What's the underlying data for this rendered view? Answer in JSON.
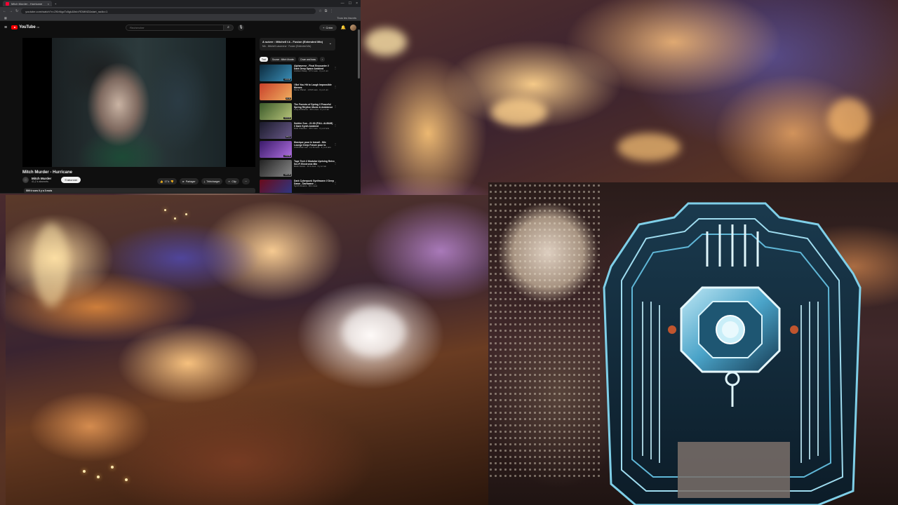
{
  "browser": {
    "tab_title": "Mitch Murder - Hurricane",
    "url": "youtube.com/watch?v=ZKbNgcTo5gk&list=RDMMZ&start_radio=1",
    "bookmarks_right": "Tous les favoris"
  },
  "youtube": {
    "logo_text": "YouTube",
    "logo_region": "FR",
    "search_placeholder": "Rechercher",
    "create_label": "Créer",
    "video_title": "Mitch Murder - Hurricane",
    "channel_name": "Mitch Murder",
    "channel_subs": "41,2 k abonnés",
    "subscribe_label": "S'abonner",
    "actions": {
      "like_count": "17 k",
      "share": "Partager",
      "download": "Télécharger",
      "clip": "Clip"
    },
    "views_line": "509 k vues  il y a 3 mois",
    "live_chat": {
      "title": "A suivre : Mitchell t.k - Fusion (Extended Mix)",
      "subtitle": "Mix - Mitchell Lasonneur · Fusion (Extended Mix)"
    },
    "chips": [
      "Tout",
      "Source : Mitch Murder",
      "Drum and bass"
    ],
    "recommendations": [
      {
        "title": "Alphaverse - Final Encounter // Dark Deep Space Ambient",
        "meta": "Ambient Sleep · 27 k vues · il y a 1 an",
        "duration": "1:00:00",
        "colors": [
          "#0c2a3d",
          "#3a8fb8"
        ]
      },
      {
        "title": "I Bet You Hit to Laugh Impossible Memes",
        "meta": "Meme Planet · 1,8 M vues · il y a 1 an",
        "duration": "12:44",
        "colors": [
          "#c9402a",
          "#f0b060"
        ]
      },
      {
        "title": "The Forests of Spring // Peaceful Spring Rhythm Music & Ambience",
        "meta": "Cozy Ambience · 60 k vues · il y a 1 an",
        "duration": "3:00:04",
        "colors": [
          "#3b5a2a",
          "#b8c47a"
        ]
      },
      {
        "title": "Soldier Sun - 21:00 (FULL ALBUM) // Dark Synth Ambient",
        "meta": "Dark Chamber · 40 k vues · il y a 2 ans",
        "duration": "45:12",
        "colors": [
          "#1a1a2a",
          "#6a5a8a"
        ]
      },
      {
        "title": "Musique pour le travail - Mix Lounge Deep Future pour la concentration",
        "meta": "Chill Music Lab · 2,1 M vues · il y a 2 ans",
        "duration": "2:59:58",
        "colors": [
          "#3a1a6a",
          "#b070e0"
        ]
      },
      {
        "title": "Tape Tech // Modular Uprising Retro Sci-Fi Electronic Mix",
        "meta": "Retro Future · 31 k vues · il y a 1 an",
        "duration": "1:01:22",
        "colors": [
          "#222222",
          "#8a8a8a"
        ]
      },
      {
        "title": "Dark Cyberpunk Synthwave // Deep Dawn - Darkwave ...",
        "meta": "Synth Dreams · 84 k vues",
        "duration": "DARK",
        "colors": [
          "#6a0a1a",
          "#2a3a8a"
        ]
      }
    ]
  }
}
